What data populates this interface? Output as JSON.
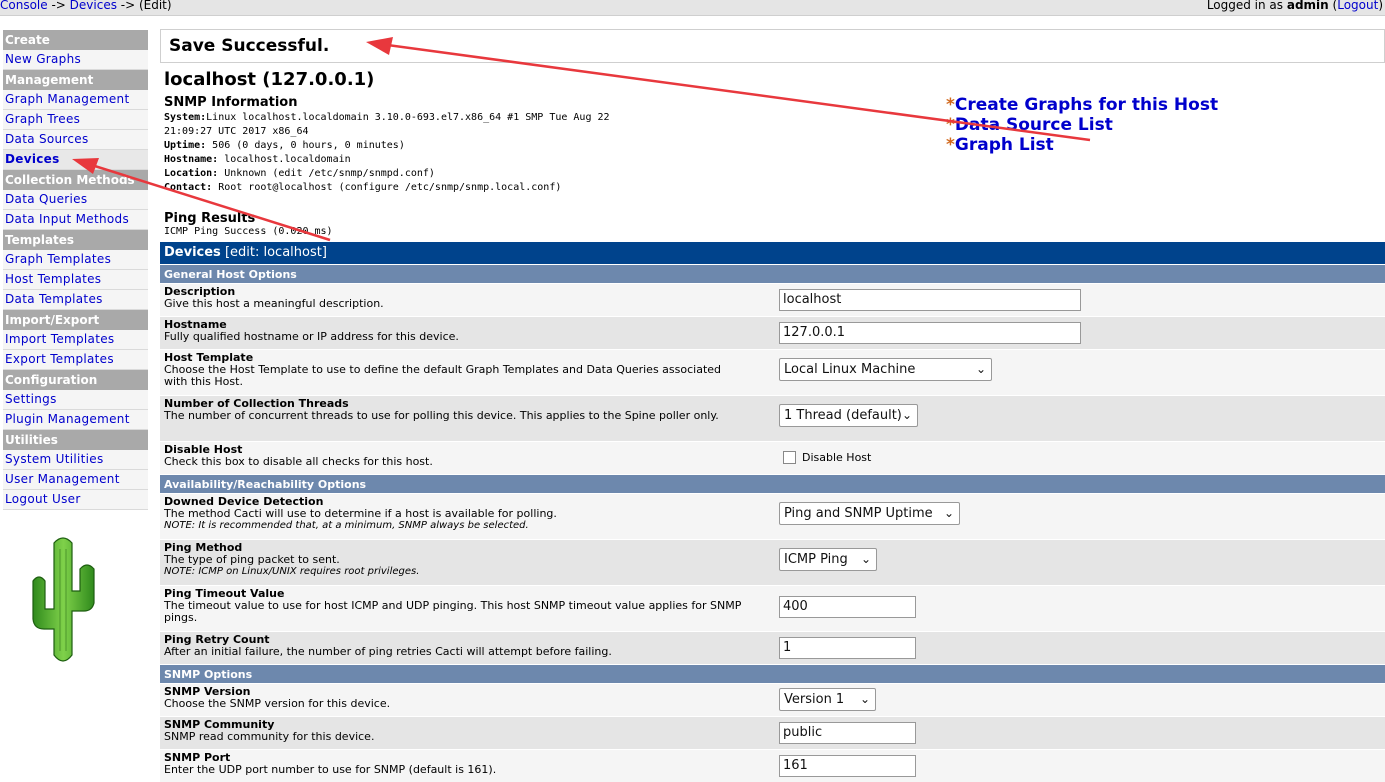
{
  "topbar": {
    "crumb_console": "Console",
    "crumb_sep1": " -> ",
    "crumb_devices": "Devices",
    "crumb_sep2": " -> (Edit)",
    "logged_in_prefix": "Logged in as ",
    "user": "admin",
    "logout_open": " (",
    "logout_label": "Logout",
    "logout_close": ")"
  },
  "menu": [
    {
      "type": "head",
      "label": "Create"
    },
    {
      "type": "item",
      "label": "New Graphs"
    },
    {
      "type": "head",
      "label": "Management"
    },
    {
      "type": "item",
      "label": "Graph Management"
    },
    {
      "type": "item",
      "label": "Graph Trees"
    },
    {
      "type": "item",
      "label": "Data Sources"
    },
    {
      "type": "item",
      "label": "Devices",
      "active": true
    },
    {
      "type": "head",
      "label": "Collection Methods"
    },
    {
      "type": "item",
      "label": "Data Queries"
    },
    {
      "type": "item",
      "label": "Data Input Methods"
    },
    {
      "type": "head",
      "label": "Templates"
    },
    {
      "type": "item",
      "label": "Graph Templates"
    },
    {
      "type": "item",
      "label": "Host Templates"
    },
    {
      "type": "item",
      "label": "Data Templates"
    },
    {
      "type": "head",
      "label": "Import/Export"
    },
    {
      "type": "item",
      "label": "Import Templates"
    },
    {
      "type": "item",
      "label": "Export Templates"
    },
    {
      "type": "head",
      "label": "Configuration"
    },
    {
      "type": "item",
      "label": "Settings"
    },
    {
      "type": "item",
      "label": "Plugin Management"
    },
    {
      "type": "head",
      "label": "Utilities"
    },
    {
      "type": "item",
      "label": "System Utilities"
    },
    {
      "type": "item",
      "label": "User Management"
    },
    {
      "type": "item",
      "label": "Logout User"
    }
  ],
  "message": "Save Successful.",
  "host_title": "localhost (127.0.0.1)",
  "snmp": {
    "title": "SNMP Information",
    "system_label": "System:",
    "system_value": "Linux localhost.localdomain 3.10.0-693.el7.x86_64 #1 SMP Tue Aug 22",
    "system_value2": "21:09:27 UTC 2017 x86_64",
    "uptime_label": "Uptime:",
    "uptime_value": " 506 (0 days, 0 hours, 0 minutes)",
    "hostname_label": "Hostname:",
    "hostname_value": " localhost.localdomain",
    "location_label": "Location:",
    "location_value": " Unknown (edit /etc/snmp/snmpd.conf)",
    "contact_label": "Contact:",
    "contact_value": " Root root@localhost (configure /etc/snmp/snmp.local.conf)"
  },
  "ping": {
    "title": "Ping Results",
    "text": "ICMP Ping Success (0.020 ms)"
  },
  "quicklinks": [
    {
      "star": "*",
      "label": "Create Graphs for this Host"
    },
    {
      "star": "*",
      "label": "Data Source List"
    },
    {
      "star": "*",
      "label": "Graph List"
    }
  ],
  "table": {
    "header_title": "Devices",
    "header_suffix": " [edit: localhost]"
  },
  "sections": {
    "general": "General Host Options",
    "availability": "Availability/Reachability Options",
    "snmp": "SNMP Options"
  },
  "fields": {
    "description": {
      "title": "Description",
      "desc": "Give this host a meaningful description.",
      "value": "localhost"
    },
    "hostname": {
      "title": "Hostname",
      "desc": "Fully qualified hostname or IP address for this device.",
      "value": "127.0.0.1"
    },
    "host_template": {
      "title": "Host Template",
      "desc": "Choose the Host Template to use to define the default Graph Templates and Data Queries associated with this Host.",
      "value": "Local Linux Machine"
    },
    "threads": {
      "title": "Number of Collection Threads",
      "desc": "The number of concurrent threads to use for polling this device. This applies to the Spine poller only.",
      "value": "1 Thread (default)"
    },
    "disable_host": {
      "title": "Disable Host",
      "desc": "Check this box to disable all checks for this host.",
      "checkbox_label": "Disable Host"
    },
    "downed_detection": {
      "title": "Downed Device Detection",
      "desc": "The method Cacti will use to determine if a host is available for polling.",
      "note": "NOTE: It is recommended that, at a minimum, SNMP always be selected.",
      "value": "Ping and SNMP Uptime"
    },
    "ping_method": {
      "title": "Ping Method",
      "desc": "The type of ping packet to sent.",
      "note": "NOTE: ICMP on Linux/UNIX requires root privileges.",
      "value": "ICMP Ping"
    },
    "ping_timeout": {
      "title": "Ping Timeout Value",
      "desc": "The timeout value to use for host ICMP and UDP pinging. This host SNMP timeout value applies for SNMP pings.",
      "value": "400"
    },
    "ping_retry": {
      "title": "Ping Retry Count",
      "desc": "After an initial failure, the number of ping retries Cacti will attempt before failing.",
      "value": "1"
    },
    "snmp_version": {
      "title": "SNMP Version",
      "desc": "Choose the SNMP version for this device.",
      "value": "Version 1"
    },
    "snmp_community": {
      "title": "SNMP Community",
      "desc": "SNMP read community for this device.",
      "value": "public"
    },
    "snmp_port": {
      "title": "SNMP Port",
      "desc": "Enter the UDP port number to use for SNMP (default is 161).",
      "value": "161"
    }
  },
  "colors": {
    "menu_head": "#a9a9a9",
    "table_header": "#00438c",
    "section_header": "#6d88ad",
    "link": "#0000cc",
    "star": "#d2691e",
    "annotation_arrow": "#e8383d"
  }
}
